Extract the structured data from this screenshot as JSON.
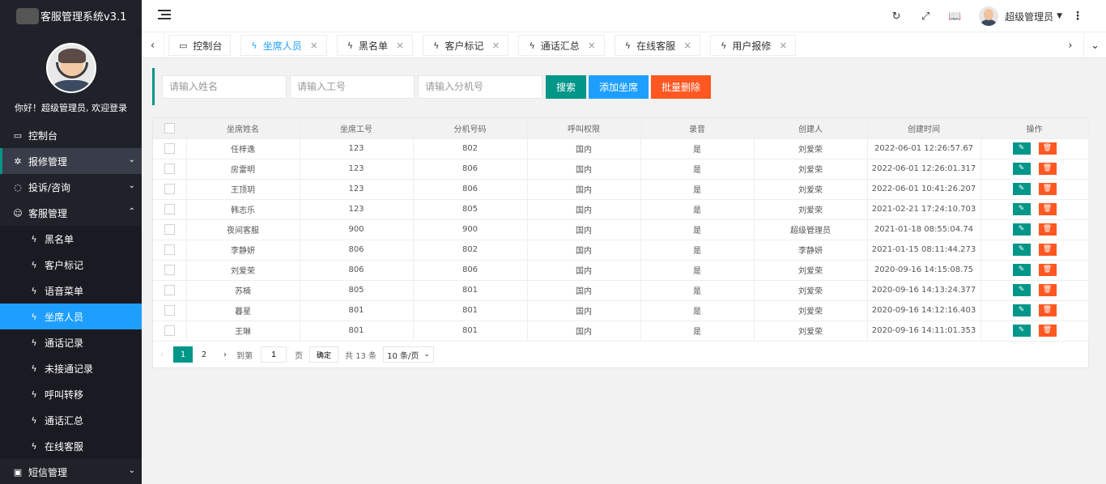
{
  "app": {
    "title": "客服管理系统v3.1"
  },
  "sidebar": {
    "welcome": "你好！超级管理员, 欢迎登录",
    "items": [
      {
        "label": "控制台",
        "icon": "monitor-icon"
      },
      {
        "label": "报修管理",
        "icon": "wrench-icon"
      },
      {
        "label": "投诉/咨询",
        "icon": "chat-icon"
      },
      {
        "label": "客服管理",
        "icon": "user-icon"
      }
    ],
    "sub_items": [
      {
        "label": "黑名单"
      },
      {
        "label": "客户标记"
      },
      {
        "label": "语音菜单"
      },
      {
        "label": "坐席人员"
      },
      {
        "label": "通话记录"
      },
      {
        "label": "未接通记录"
      },
      {
        "label": "呼叫转移"
      },
      {
        "label": "通话汇总"
      },
      {
        "label": "在线客服"
      }
    ],
    "last_item": {
      "label": "短信管理",
      "icon": "sms-icon"
    }
  },
  "header": {
    "admin_name": "超级管理员",
    "icons": [
      "menu-toggle-icon",
      "refresh-icon",
      "fullscreen-icon",
      "book-icon",
      "more-vertical-icon"
    ]
  },
  "tabs": [
    {
      "label": "控制台",
      "closable": false,
      "active": false
    },
    {
      "label": "坐席人员",
      "closable": true,
      "active": true
    },
    {
      "label": "黑名单",
      "closable": true,
      "active": false
    },
    {
      "label": "客户标记",
      "closable": true,
      "active": false
    },
    {
      "label": "通话汇总",
      "closable": true,
      "active": false
    },
    {
      "label": "在线客服",
      "closable": true,
      "active": false
    },
    {
      "label": "用户报修",
      "closable": true,
      "active": false
    }
  ],
  "search": {
    "name_placeholder": "请输入姓名",
    "id_placeholder": "请输入工号",
    "ext_placeholder": "请输入分机号",
    "search_label": "搜索",
    "add_label": "添加坐席",
    "batch_delete_label": "批量删除"
  },
  "table": {
    "columns": [
      "坐席姓名",
      "坐席工号",
      "分机号码",
      "呼叫权限",
      "录音",
      "创建人",
      "创建时间",
      "操作"
    ],
    "rows": [
      [
        "任梓逸",
        "123",
        "802",
        "国内",
        "是",
        "刘爱荣",
        "2022-06-01 12:26:57.67"
      ],
      [
        "房雷明",
        "123",
        "806",
        "国内",
        "是",
        "刘爱荣",
        "2022-06-01 12:26:01.317"
      ],
      [
        "王顶玥",
        "123",
        "806",
        "国内",
        "是",
        "刘爱荣",
        "2022-06-01 10:41:26.207"
      ],
      [
        "韩志乐",
        "123",
        "805",
        "国内",
        "是",
        "刘爱荣",
        "2021-02-21 17:24:10.703"
      ],
      [
        "夜间客服",
        "900",
        "900",
        "国内",
        "是",
        "超级管理员",
        "2021-01-18 08:55:04.74"
      ],
      [
        "李静妍",
        "806",
        "802",
        "国内",
        "是",
        "李静妍",
        "2021-01-15 08:11:44.273"
      ],
      [
        "刘爱荣",
        "806",
        "806",
        "国内",
        "是",
        "刘爱荣",
        "2020-09-16 14:15:08.75"
      ],
      [
        "苏楠",
        "805",
        "801",
        "国内",
        "是",
        "刘爱荣",
        "2020-09-16 14:13:24.377"
      ],
      [
        "暮星",
        "801",
        "801",
        "国内",
        "是",
        "刘爱荣",
        "2020-09-16 14:12:16.403"
      ],
      [
        "王琳",
        "801",
        "801",
        "国内",
        "是",
        "刘爱荣",
        "2020-09-16 14:11:01.353"
      ]
    ]
  },
  "pager": {
    "prev": "‹",
    "pages": [
      "1",
      "2"
    ],
    "next": "›",
    "goto_label": "到第",
    "goto_value": "1",
    "page_unit": "页",
    "confirm_label": "确定",
    "total_label": "共 13 条",
    "page_size": "10 条/页"
  }
}
